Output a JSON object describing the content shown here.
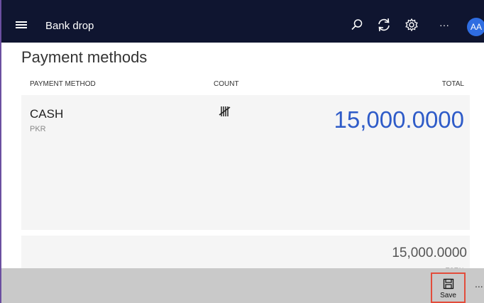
{
  "app": {
    "title": "Bank drop",
    "avatar_initials": "AA",
    "more_label": "···"
  },
  "page": {
    "title": "Payment methods"
  },
  "table": {
    "columns": [
      "PAYMENT METHOD",
      "COUNT",
      "TOTAL"
    ],
    "rows": [
      {
        "method": "CASH",
        "currency": "PKR",
        "total": "15,000.0000"
      }
    ]
  },
  "summary": {
    "total": "15,000.0000",
    "label": "TOTAL"
  },
  "footer": {
    "save_label": "Save",
    "more_label": "..."
  },
  "colors": {
    "topbar": "#0f1530",
    "accent": "#2e5bc8",
    "avatar": "#2f6de1",
    "highlight": "#e24c3b",
    "footer": "#c9c9c9"
  },
  "icons": [
    "hamburger-icon",
    "search-icon",
    "refresh-icon",
    "gear-icon",
    "more-icon",
    "tally-icon",
    "save-icon"
  ]
}
